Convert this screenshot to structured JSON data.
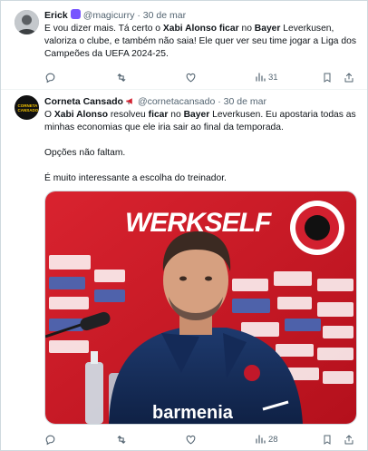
{
  "tweets": [
    {
      "author_name": "Erick",
      "handle": "@magicurry",
      "separator": "·",
      "date": "30 de mar",
      "text_lines": [
        "E vou dizer mais. Tá certo o Xabi Alonso ficar no Bayer Leverkusen,",
        "valoriza o clube, e também não saia! Ele quer ver seu time jogar a Liga dos",
        "Campeões da UEFA 2024-25."
      ],
      "views": "31"
    },
    {
      "author_name": "Corneta Cansado",
      "handle": "@cornetacansado",
      "separator": "·",
      "date": "30 de mar",
      "avatar_text": "CORNETA CANSADO",
      "paragraphs": [
        "O Xabi Alonso resolveu ficar no Bayer Leverkusen. Eu apostaria todas as minhas economias que ele iria sair ao final da temporada.",
        "Opções não faltam.",
        "É muito interessante a escolha do treinador."
      ],
      "image": {
        "backdrop_text": "WERKSELF",
        "shirt_text": "barmenia"
      },
      "views": "28"
    }
  ],
  "icons": [
    "reply-icon",
    "retweet-icon",
    "like-icon",
    "views-icon",
    "bookmark-icon",
    "share-icon"
  ],
  "colors": {
    "text": "#0f1419",
    "muted": "#536471",
    "border": "#cfd9de",
    "bayer_red": "#d2202f",
    "verified_purple": "#7856ff"
  }
}
